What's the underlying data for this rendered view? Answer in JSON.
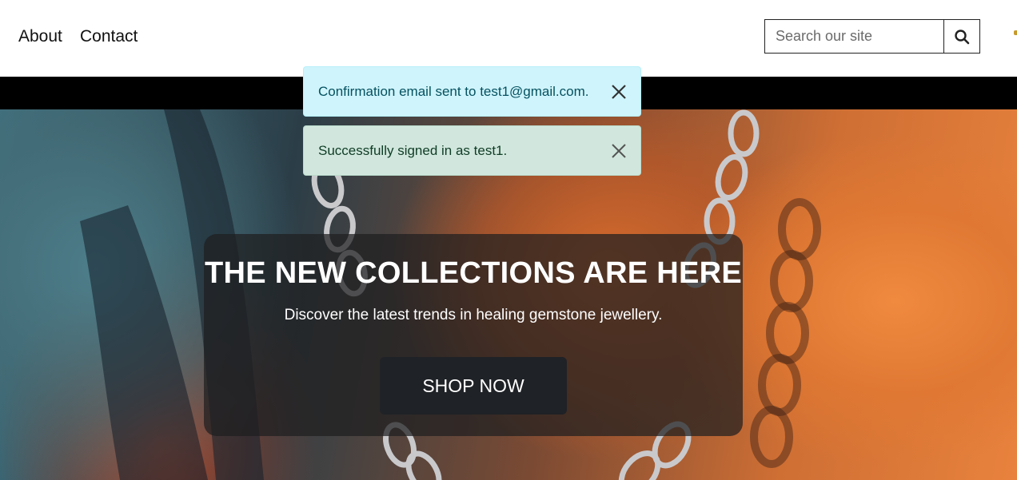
{
  "nav": {
    "partial_label": "p",
    "items": [
      "About",
      "Contact"
    ]
  },
  "search": {
    "placeholder": "Search our site",
    "icon": "search-icon"
  },
  "alerts": [
    {
      "type": "info",
      "message": "Confirmation email sent to test1@gmail.com.",
      "color": "#cff4fc"
    },
    {
      "type": "success",
      "message": "Successfully signed in as test1.",
      "color": "#d1e7dd"
    }
  ],
  "hero": {
    "title": "THE NEW COLLECTIONS ARE HERE",
    "subtitle": "Discover the latest trends in healing gemstone jewellery.",
    "cta_label": "SHOP NOW"
  },
  "colors": {
    "topbar": "#000000",
    "accent": "#1f2226"
  }
}
